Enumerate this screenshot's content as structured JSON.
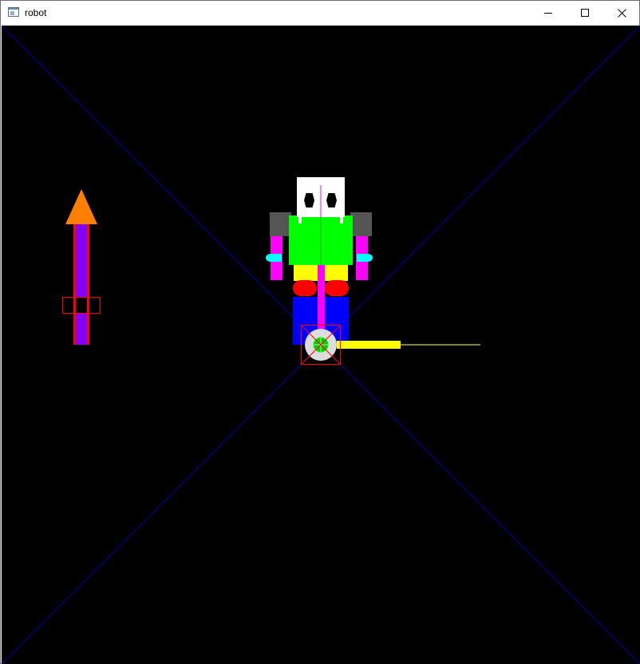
{
  "window": {
    "title": "robot",
    "controls": [
      "minimize",
      "maximize",
      "close"
    ]
  },
  "scene": {
    "background": "#000000",
    "colors": {
      "diagonals": "#0000aa",
      "arrow_head": "#ff7f00",
      "arrow_shaft": "#8000ff",
      "arrow_outline": "#ff0000",
      "head": "#ffffff",
      "eyes": "#000000",
      "shoulders": "#555555",
      "torso": "#00ff00",
      "arms": "#ff00ff",
      "hands": "#00ffff",
      "hips": "#ffff00",
      "knees": "#ff0000",
      "legs": "#0000ff",
      "spine": "#ff00ff",
      "wheel": "#dddddd",
      "wheel_hub": "#00ff00",
      "wheel_box": "#ff0000",
      "ground_bar": "#ffff00"
    }
  }
}
